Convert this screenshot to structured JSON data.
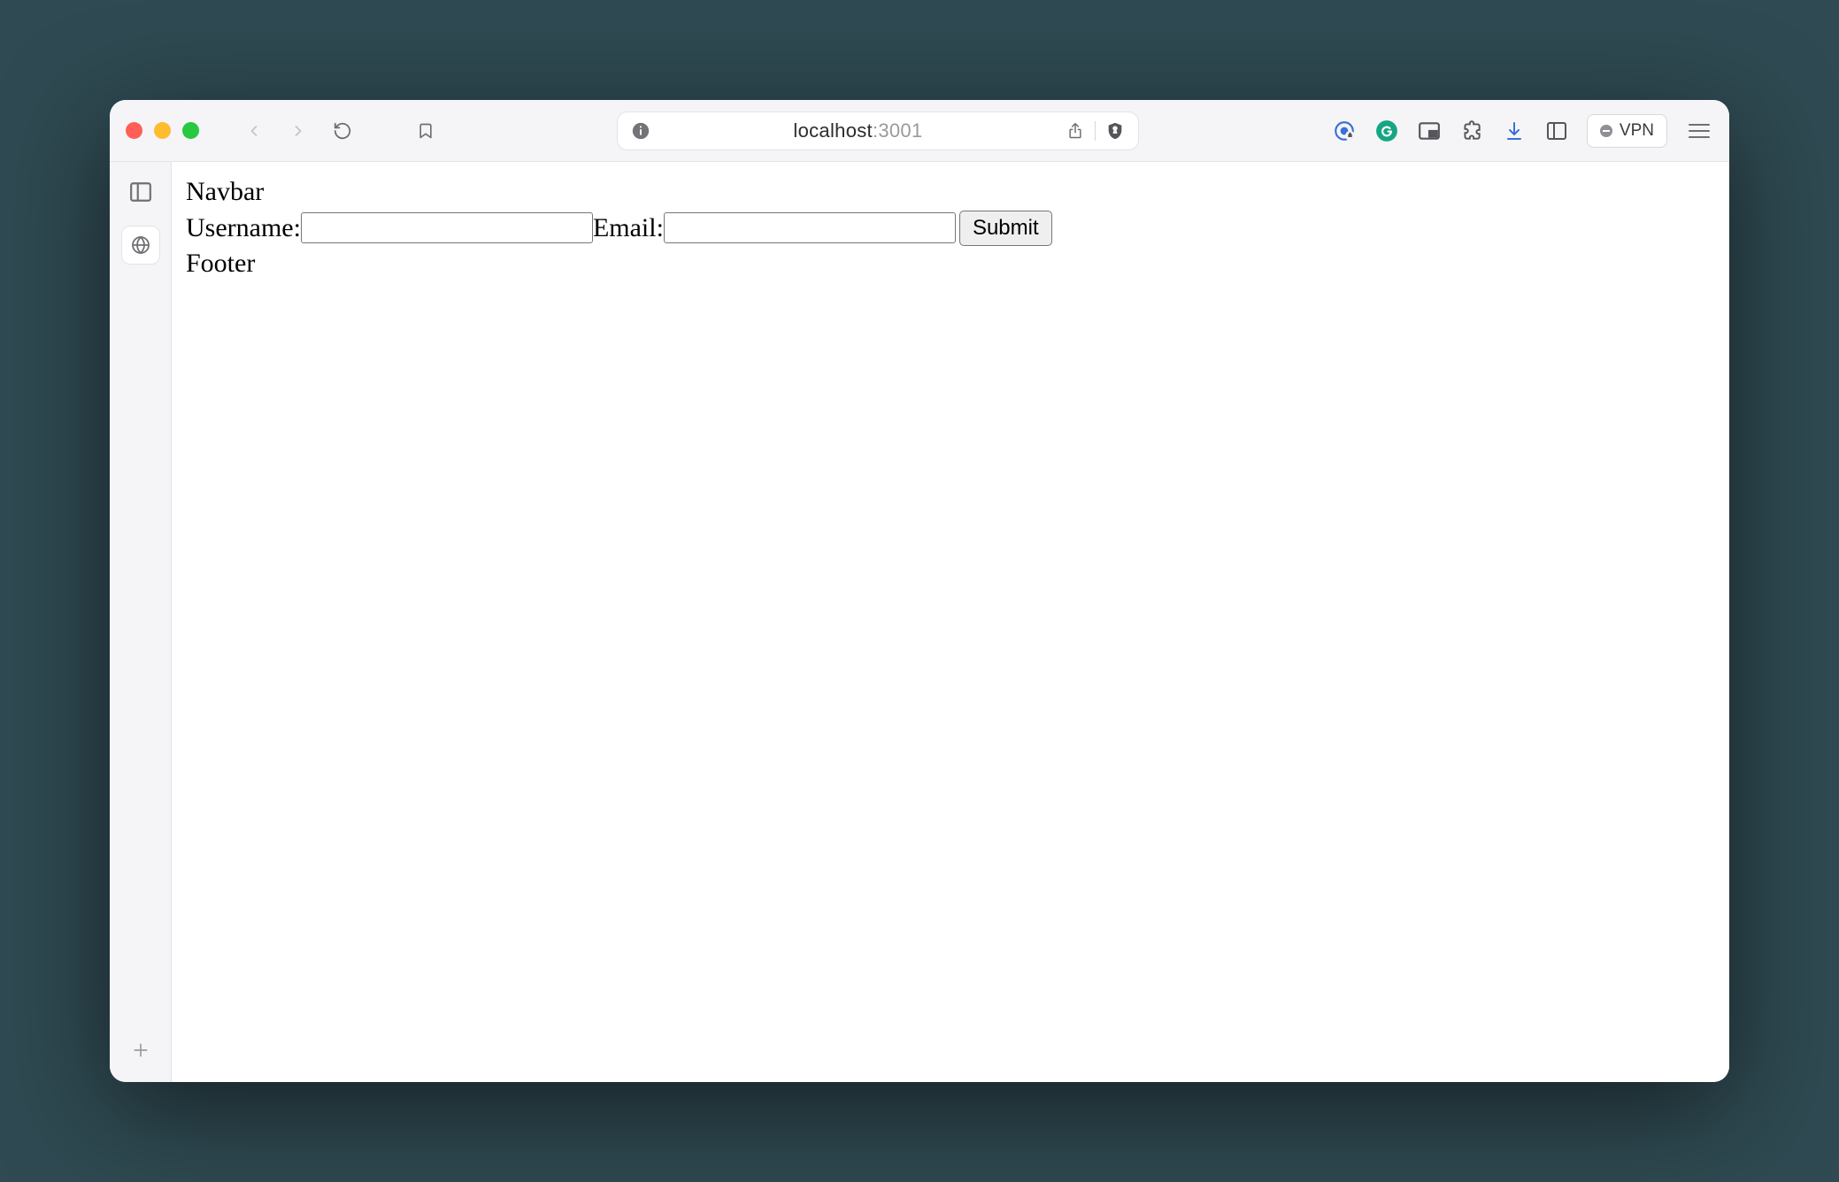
{
  "address": {
    "host": "localhost",
    "port": ":3001"
  },
  "vpn": {
    "label": "VPN"
  },
  "page": {
    "navbar_text": "Navbar",
    "footer_text": "Footer",
    "form": {
      "username_label": "Username:",
      "username_value": "",
      "email_label": "Email:",
      "email_value": "",
      "submit_label": "Submit"
    }
  }
}
